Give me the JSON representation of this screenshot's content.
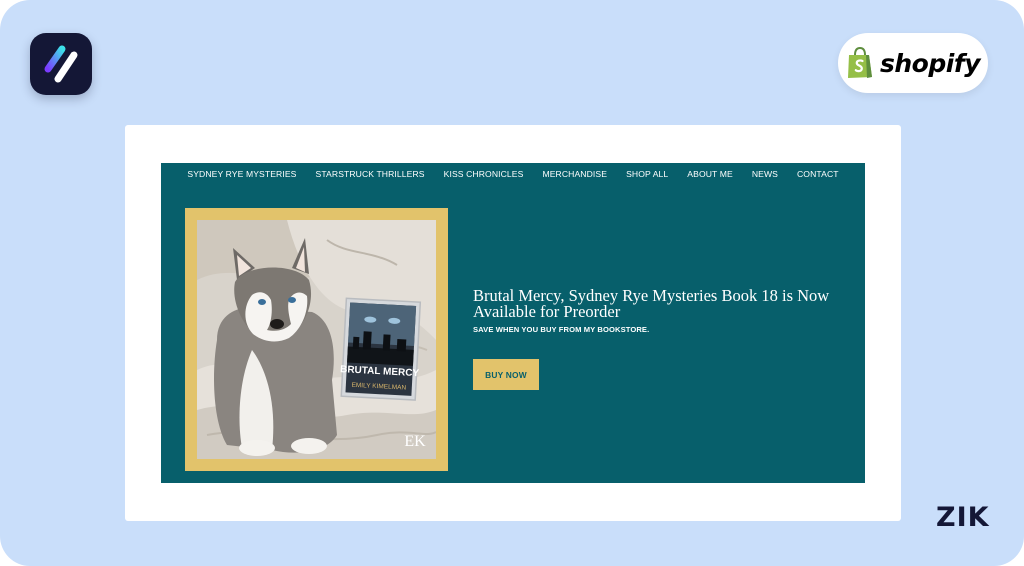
{
  "branding": {
    "shopify_label": "shopify",
    "zik_label": "ZIK"
  },
  "nav": {
    "items": [
      {
        "label": "SYDNEY RYE MYSTERIES"
      },
      {
        "label": "STARSTRUCK THRILLERS"
      },
      {
        "label": "KISS CHRONICLES"
      },
      {
        "label": "MERCHANDISE"
      },
      {
        "label": "SHOP ALL"
      },
      {
        "label": "ABOUT ME"
      },
      {
        "label": "NEWS"
      },
      {
        "label": "CONTACT"
      }
    ]
  },
  "hero": {
    "headline": "Brutal Mercy, Sydney Rye Mysteries Book 18 is Now Available for Preorder",
    "subline": "SAVE WHEN YOU BUY FROM MY BOOKSTORE.",
    "cta_label": "BUY NOW",
    "book": {
      "title": "BRUTAL MERCY",
      "author": "EMILY KIMELMAN"
    },
    "watermark": "EK"
  },
  "colors": {
    "page_background": "#c9defa",
    "site_teal": "#075f6b",
    "accent_gold": "#e2c36b",
    "app_logo_dark": "#141736",
    "shopify_green": "#95bf47"
  }
}
